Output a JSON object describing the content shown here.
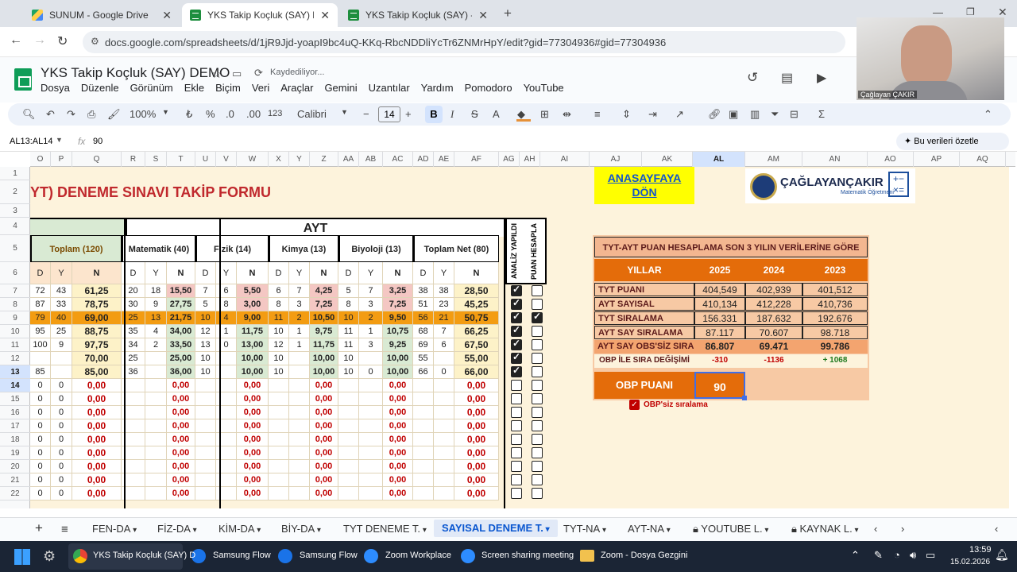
{
  "browser": {
    "tabs": [
      {
        "title": "SUNUM - Google Drive",
        "icon": "drive-icon"
      },
      {
        "title": "YKS Takip Koçluk (SAY) DEMO -",
        "icon": "sheets-icon"
      },
      {
        "title": "YKS Takip Koçluk (SAY) - Google",
        "icon": "sheets-icon"
      }
    ],
    "url": "docs.google.com/spreadsheets/d/1jR9Jjd-yoapI9bc4uQ-KKq-RbcNDDliYcTr6ZNMrHpY/edit?gid=77304936#gid=77304936"
  },
  "doc": {
    "title": "YKS Takip Koçluk (SAY) DEMO",
    "saving": "Kaydediliyor...",
    "menu": [
      "Dosya",
      "Düzenle",
      "Görünüm",
      "Ekle",
      "Biçim",
      "Veri",
      "Araçlar",
      "Gemini",
      "Uzantılar",
      "Yardım",
      "Pomodoro",
      "YouTube"
    ]
  },
  "toolbar": {
    "zoom": "100%",
    "currency": "₺",
    "percent": "%",
    "dec_less": ".0",
    "dec_more": ".00",
    "number_format": "123",
    "font": "Calibri",
    "font_size": "14"
  },
  "formula": {
    "range": "AL13:AL14",
    "fx": "fx",
    "value": "90",
    "summarize": "Bu verileri özetle"
  },
  "webcam_name": "Çağlayan ÇAKIR",
  "columns": [
    "O",
    "P",
    "Q",
    "R",
    "S",
    "T",
    "U",
    "V",
    "W",
    "X",
    "Y",
    "Z",
    "AA",
    "AB",
    "AC",
    "AD",
    "AE",
    "AF",
    "AG",
    "AH",
    "AI",
    "AJ",
    "AK",
    "AL",
    "AM",
    "AN",
    "AO",
    "AP",
    "AQ"
  ],
  "rows": [
    "1",
    "2",
    "3",
    "4",
    "5",
    "6",
    "7",
    "8",
    "9",
    "10",
    "11",
    "12",
    "13",
    "14",
    "15",
    "16",
    "17",
    "18",
    "19",
    "20",
    "21",
    "22"
  ],
  "sheet": {
    "form_title": "YT) DENEME SINAVI TAKİP FORMU",
    "ayt": "AYT",
    "groups": [
      "Toplam (120)",
      "Matematik (40)",
      "Fizik (14)",
      "Kimya (13)",
      "Biyoloji (13)",
      "Toplam Net (80)"
    ],
    "dyn": [
      "D",
      "Y",
      "N"
    ],
    "analiz": "ANALİZ YAPILDI",
    "puan": "PUAN HESAPLA",
    "data_rows": [
      [
        "72",
        "43",
        "61,25",
        "20",
        "18",
        "15,50",
        "7",
        "6",
        "5,50",
        "6",
        "7",
        "4,25",
        "5",
        "7",
        "3,25",
        "38",
        "38",
        "28,50"
      ],
      [
        "87",
        "33",
        "78,75",
        "30",
        "9",
        "27,75",
        "5",
        "8",
        "3,00",
        "8",
        "3",
        "7,25",
        "8",
        "3",
        "7,25",
        "51",
        "23",
        "45,25"
      ],
      [
        "79",
        "40",
        "69,00",
        "25",
        "13",
        "21,75",
        "10",
        "4",
        "9,00",
        "11",
        "2",
        "10,50",
        "10",
        "2",
        "9,50",
        "56",
        "21",
        "50,75"
      ],
      [
        "95",
        "25",
        "88,75",
        "35",
        "4",
        "34,00",
        "12",
        "1",
        "11,75",
        "10",
        "1",
        "9,75",
        "11",
        "1",
        "10,75",
        "68",
        "7",
        "66,25"
      ],
      [
        "100",
        "9",
        "97,75",
        "34",
        "2",
        "33,50",
        "13",
        "0",
        "13,00",
        "12",
        "1",
        "11,75",
        "11",
        "3",
        "9,25",
        "69",
        "6",
        "67,50"
      ],
      [
        "",
        "",
        "70,00",
        "25",
        "",
        "25,00",
        "10",
        "",
        "10,00",
        "10",
        "",
        "10,00",
        "10",
        "",
        "10,00",
        "55",
        "",
        "55,00"
      ],
      [
        "85",
        "",
        "85,00",
        "36",
        "",
        "36,00",
        "10",
        "",
        "10,00",
        "10",
        "",
        "10,00",
        "10",
        "0",
        "10,00",
        "66",
        "0",
        "66,00"
      ]
    ],
    "zero_rows": [
      [
        "0",
        "0",
        "0,00",
        "",
        "",
        "0,00",
        "",
        "",
        "0,00",
        "",
        "",
        "0,00",
        "",
        "",
        "0,00",
        "",
        "",
        "0,00"
      ],
      [
        "0",
        "0",
        "0,00",
        "",
        "",
        "0,00",
        "",
        "",
        "0,00",
        "",
        "",
        "0,00",
        "",
        "",
        "0,00",
        "",
        "",
        "0,00"
      ],
      [
        "0",
        "0",
        "0,00",
        "",
        "",
        "0,00",
        "",
        "",
        "0,00",
        "",
        "",
        "0,00",
        "",
        "",
        "0,00",
        "",
        "",
        "0,00"
      ],
      [
        "0",
        "0",
        "0,00",
        "",
        "",
        "0,00",
        "",
        "",
        "0,00",
        "",
        "",
        "0,00",
        "",
        "",
        "0,00",
        "",
        "",
        "0,00"
      ],
      [
        "0",
        "0",
        "0,00",
        "",
        "",
        "0,00",
        "",
        "",
        "0,00",
        "",
        "",
        "0,00",
        "",
        "",
        "0,00",
        "",
        "",
        "0,00"
      ],
      [
        "0",
        "0",
        "0,00",
        "",
        "",
        "0,00",
        "",
        "",
        "0,00",
        "",
        "",
        "0,00",
        "",
        "",
        "0,00",
        "",
        "",
        "0,00"
      ],
      [
        "0",
        "0",
        "0,00",
        "",
        "",
        "0,00",
        "",
        "",
        "0,00",
        "",
        "",
        "0,00",
        "",
        "",
        "0,00",
        "",
        "",
        "0,00"
      ],
      [
        "0",
        "0",
        "0,00",
        "",
        "",
        "0,00",
        "",
        "",
        "0,00",
        "",
        "",
        "0,00",
        "",
        "",
        "0,00",
        "",
        "",
        "0,00"
      ],
      [
        "0",
        "0",
        "0,00",
        "",
        "",
        "0,00",
        "",
        "",
        "0,00",
        "",
        "",
        "0,00",
        "",
        "",
        "0,00",
        "",
        "",
        "0,00"
      ]
    ],
    "analiz_checks": [
      true,
      true,
      true,
      true,
      true,
      true,
      true,
      false,
      false,
      false,
      false,
      false,
      false,
      false,
      false,
      false
    ],
    "puan_checks": [
      false,
      false,
      true,
      false,
      false,
      false,
      false,
      false,
      false,
      false,
      false,
      false,
      false,
      false,
      false,
      false
    ],
    "anasayfa": "ANASAYFAYA DÖN",
    "logo_name": "ÇAĞLAYANÇAKIR",
    "logo_sub": "Matematik Öğretmeni",
    "calc_title": "TYT-AYT PUAN HESAPLAMA SON 3 YILIN VERİLERİNE GÖRE",
    "years_label": "YILLAR",
    "years": [
      "2025",
      "2024",
      "2023"
    ],
    "calc_rows": [
      [
        "TYT PUANI",
        "404,549",
        "402,939",
        "401,512"
      ],
      [
        "AYT SAYISAL",
        "410,134",
        "412,228",
        "410,736"
      ],
      [
        "TYT SIRALAMA",
        "156.331",
        "187.632",
        "192.676"
      ],
      [
        "AYT SAY SIRALAMA",
        "87.117",
        "70.607",
        "98.718"
      ],
      [
        "AYT SAY OBS'SİZ SIRA",
        "86.807",
        "69.471",
        "99.786"
      ],
      [
        "OBP İLE SIRA DEĞİŞİMİ",
        "-310",
        "-1136",
        "+ 1068"
      ]
    ],
    "obp_label": "OBP PUANI",
    "obp_value": "90",
    "obp_check_label": "OBP'siz sıralama"
  },
  "sheet_tabs": [
    "FEN-DA",
    "FİZ-DA",
    "KİM-DA",
    "BİY-DA",
    "TYT DENEME T.",
    "SAYISAL DENEME T.",
    "TYT-NA",
    "AYT-NA",
    "YOUTUBE L.",
    "KAYNAK L."
  ],
  "taskbar": {
    "apps": [
      "YKS Takip Koçluk (SAY) D",
      "Samsung Flow",
      "Samsung Flow",
      "Zoom Workplace",
      "Screen sharing meeting",
      "Zoom - Dosya Gezgini"
    ],
    "time": "13:59",
    "date": "15.02.2026"
  }
}
